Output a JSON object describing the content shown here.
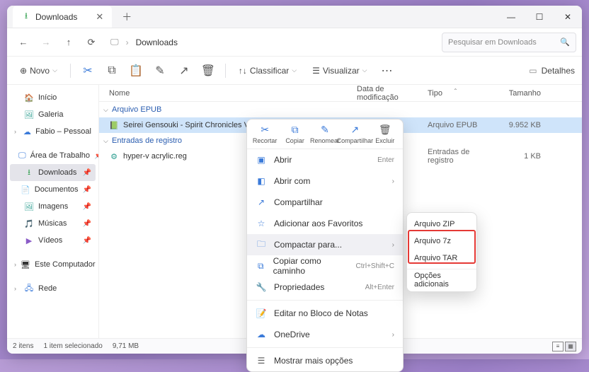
{
  "titlebar": {
    "tab_label": "Downloads"
  },
  "nav": {
    "breadcrumb": "Downloads",
    "search_placeholder": "Pesquisar em Downloads"
  },
  "toolbar": {
    "new_label": "Novo",
    "sort_label": "Classificar",
    "view_label": "Visualizar",
    "details_label": "Detalhes"
  },
  "columns": {
    "name": "Nome",
    "date": "Data de modificação",
    "type": "Tipo",
    "size": "Tamanho"
  },
  "sidebar": {
    "home": "Início",
    "gallery": "Galeria",
    "user": "Fabio – Pessoal",
    "desktop": "Área de Trabalho",
    "downloads": "Downloads",
    "documents": "Documentos",
    "pictures": "Imagens",
    "music": "Músicas",
    "videos": "Vídeos",
    "this_pc": "Este Computador",
    "network": "Rede"
  },
  "groups": {
    "g1": {
      "label": "Arquivo EPUB"
    },
    "g2": {
      "label": "Entradas de registro"
    }
  },
  "files": {
    "f1": {
      "name": "Seirei Gensouki - Spirit Chronicles Vol-24.epub",
      "date": "",
      "type": "Arquivo EPUB",
      "size": "9.952 KB"
    },
    "f2": {
      "name": "hyper-v acrylic.reg",
      "date": "",
      "type": "Entradas de registro",
      "size": "1 KB"
    }
  },
  "context": {
    "top": {
      "cut": "Recortar",
      "copy": "Copiar",
      "rename": "Renomear",
      "share": "Compartilhar",
      "delete": "Excluir"
    },
    "open": "Abrir",
    "open_shortcut": "Enter",
    "open_with": "Abrir com",
    "share_item": "Compartilhar",
    "favorite": "Adicionar aos Favoritos",
    "compress": "Compactar para...",
    "copy_path": "Copiar como caminho",
    "copy_path_shortcut": "Ctrl+Shift+C",
    "properties": "Propriedades",
    "properties_shortcut": "Alt+Enter",
    "notepad": "Editar no Bloco de Notas",
    "onedrive": "OneDrive",
    "more": "Mostrar mais opções"
  },
  "submenu": {
    "zip": "Arquivo ZIP",
    "sevenz": "Arquivo 7z",
    "tar": "Arquivo TAR",
    "more": "Opções adicionais"
  },
  "status": {
    "count": "2 itens",
    "selected": "1 item selecionado",
    "size": "9,71 MB"
  }
}
